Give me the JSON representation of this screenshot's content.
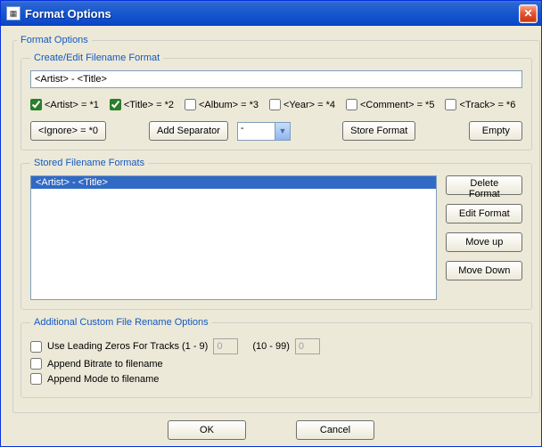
{
  "window": {
    "title": "Format Options"
  },
  "outer": {
    "legend": "Format Options"
  },
  "createEdit": {
    "legend": "Create/Edit Filename Format",
    "value": "<Artist> - <Title>",
    "tokens": {
      "artist": {
        "label": "<Artist> = *1",
        "checked": true
      },
      "title": {
        "label": "<Title> = *2",
        "checked": true
      },
      "album": {
        "label": "<Album> = *3",
        "checked": false
      },
      "year": {
        "label": "<Year> = *4",
        "checked": false
      },
      "comment": {
        "label": "<Comment> = *5",
        "checked": false
      },
      "track": {
        "label": "<Track> = *6",
        "checked": false
      }
    },
    "ignoreBtn": "<Ignore> = *0",
    "addSepBtn": "Add Separator",
    "sepValue": "-",
    "storeBtn": "Store Format",
    "emptyBtn": "Empty"
  },
  "stored": {
    "legend": "Stored Filename Formats",
    "items": [
      "<Artist> - <Title>"
    ],
    "deleteBtn": "Delete Format",
    "editBtn": "Edit Format",
    "moveUpBtn": "Move up",
    "moveDownBtn": "Move Down"
  },
  "additional": {
    "legend": "Additional Custom File Rename Options",
    "leadingZeros": {
      "label": "Use Leading Zeros For Tracks (1 - 9)",
      "val1": "0",
      "range2": "(10 - 99)",
      "val2": "0"
    },
    "appendBitrate": "Append Bitrate to filename",
    "appendMode": "Append Mode to filename"
  },
  "footer": {
    "ok": "OK",
    "cancel": "Cancel"
  }
}
